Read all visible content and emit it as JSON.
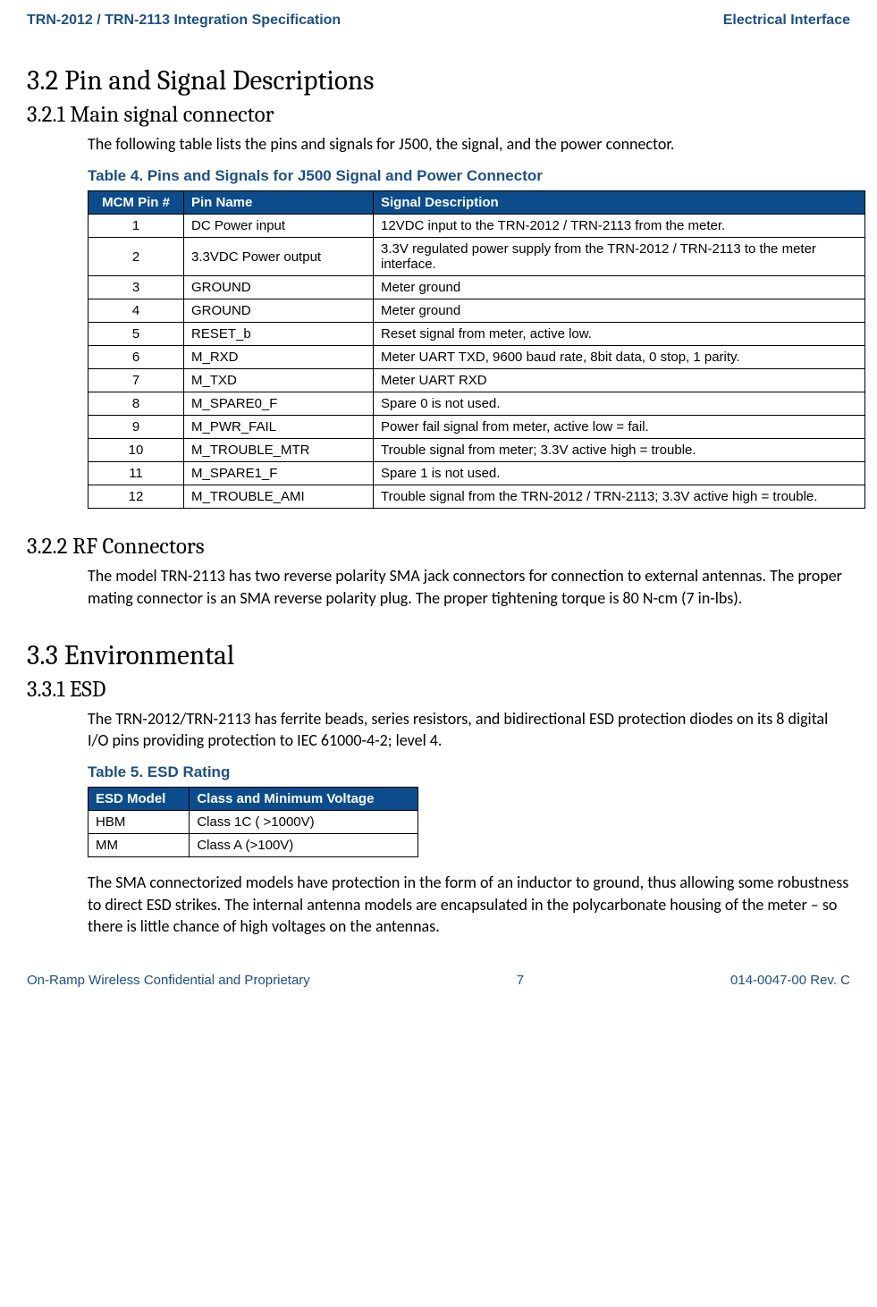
{
  "header": {
    "left": "TRN-2012 / TRN-2113 Integration Specification",
    "right": "Electrical Interface"
  },
  "sections": {
    "s32_num": "3.2",
    "s32_title": "Pin and Signal Descriptions",
    "s321_num": "3.2.1",
    "s321_title": "Main signal connector",
    "s321_body": "The following table lists the pins and signals for J500, the signal, and the power connector.",
    "s322_num": "3.2.2",
    "s322_title": "RF Connectors",
    "s322_body": "The model TRN-2113 has two reverse polarity SMA jack connectors for connection to external antennas. The proper mating connector is an SMA reverse polarity plug. The proper tightening torque is 80 N-cm (7 in-lbs).",
    "s33_num": "3.3",
    "s33_title": "Environmental",
    "s331_num": "3.3.1",
    "s331_title": "ESD",
    "s331_body1": "The TRN-2012/TRN-2113 has ferrite beads, series resistors, and bidirectional ESD protection diodes on its 8 digital I/O pins providing protection to IEC 61000-4-2; level 4.",
    "s331_body2": "The SMA connectorized models have protection in the form of an inductor to ground, thus allowing some robustness to direct ESD strikes. The internal antenna models are encapsulated in the polycarbonate housing of the meter – so there is little chance of high voltages on the antennas."
  },
  "table4": {
    "caption": "Table 4. Pins and Signals for J500 Signal and Power Connector",
    "headers": {
      "c1": "MCM Pin #",
      "c2": "Pin Name",
      "c3": "Signal Description"
    },
    "rows": [
      {
        "pin": "1",
        "name": "DC Power input",
        "desc": "12VDC input to the TRN-2012 / TRN-2113 from the meter."
      },
      {
        "pin": "2",
        "name": "3.3VDC Power output",
        "desc": "3.3V regulated power supply from the TRN-2012 / TRN-2113 to the meter interface."
      },
      {
        "pin": "3",
        "name": "GROUND",
        "desc": "Meter ground"
      },
      {
        "pin": "4",
        "name": "GROUND",
        "desc": "Meter ground"
      },
      {
        "pin": "5",
        "name": "RESET_b",
        "desc": "Reset signal from meter, active low."
      },
      {
        "pin": "6",
        "name": "M_RXD",
        "desc": "Meter UART TXD, 9600 baud rate, 8bit data, 0 stop, 1 parity."
      },
      {
        "pin": "7",
        "name": "M_TXD",
        "desc": "Meter UART RXD"
      },
      {
        "pin": "8",
        "name": "M_SPARE0_F",
        "desc": "Spare 0 is not used."
      },
      {
        "pin": "9",
        "name": "M_PWR_FAIL",
        "desc": "Power fail signal from meter, active low = fail."
      },
      {
        "pin": "10",
        "name": "M_TROUBLE_MTR",
        "desc": "Trouble signal from meter; 3.3V active high = trouble."
      },
      {
        "pin": "11",
        "name": "M_SPARE1_F",
        "desc": "Spare 1 is not used."
      },
      {
        "pin": "12",
        "name": "M_TROUBLE_AMI",
        "desc": "Trouble signal from the TRN-2012 / TRN-2113; 3.3V active high = trouble."
      }
    ]
  },
  "table5": {
    "caption": "Table 5. ESD Rating",
    "headers": {
      "c1": "ESD Model",
      "c2": "Class and Minimum Voltage"
    },
    "rows": [
      {
        "model": "HBM",
        "class": "Class 1C ( >1000V)"
      },
      {
        "model": "MM",
        "class": "Class A (>100V)"
      }
    ]
  },
  "footer": {
    "left": "On-Ramp Wireless Confidential and Proprietary",
    "center": "7",
    "right": "014-0047-00 Rev. C"
  }
}
